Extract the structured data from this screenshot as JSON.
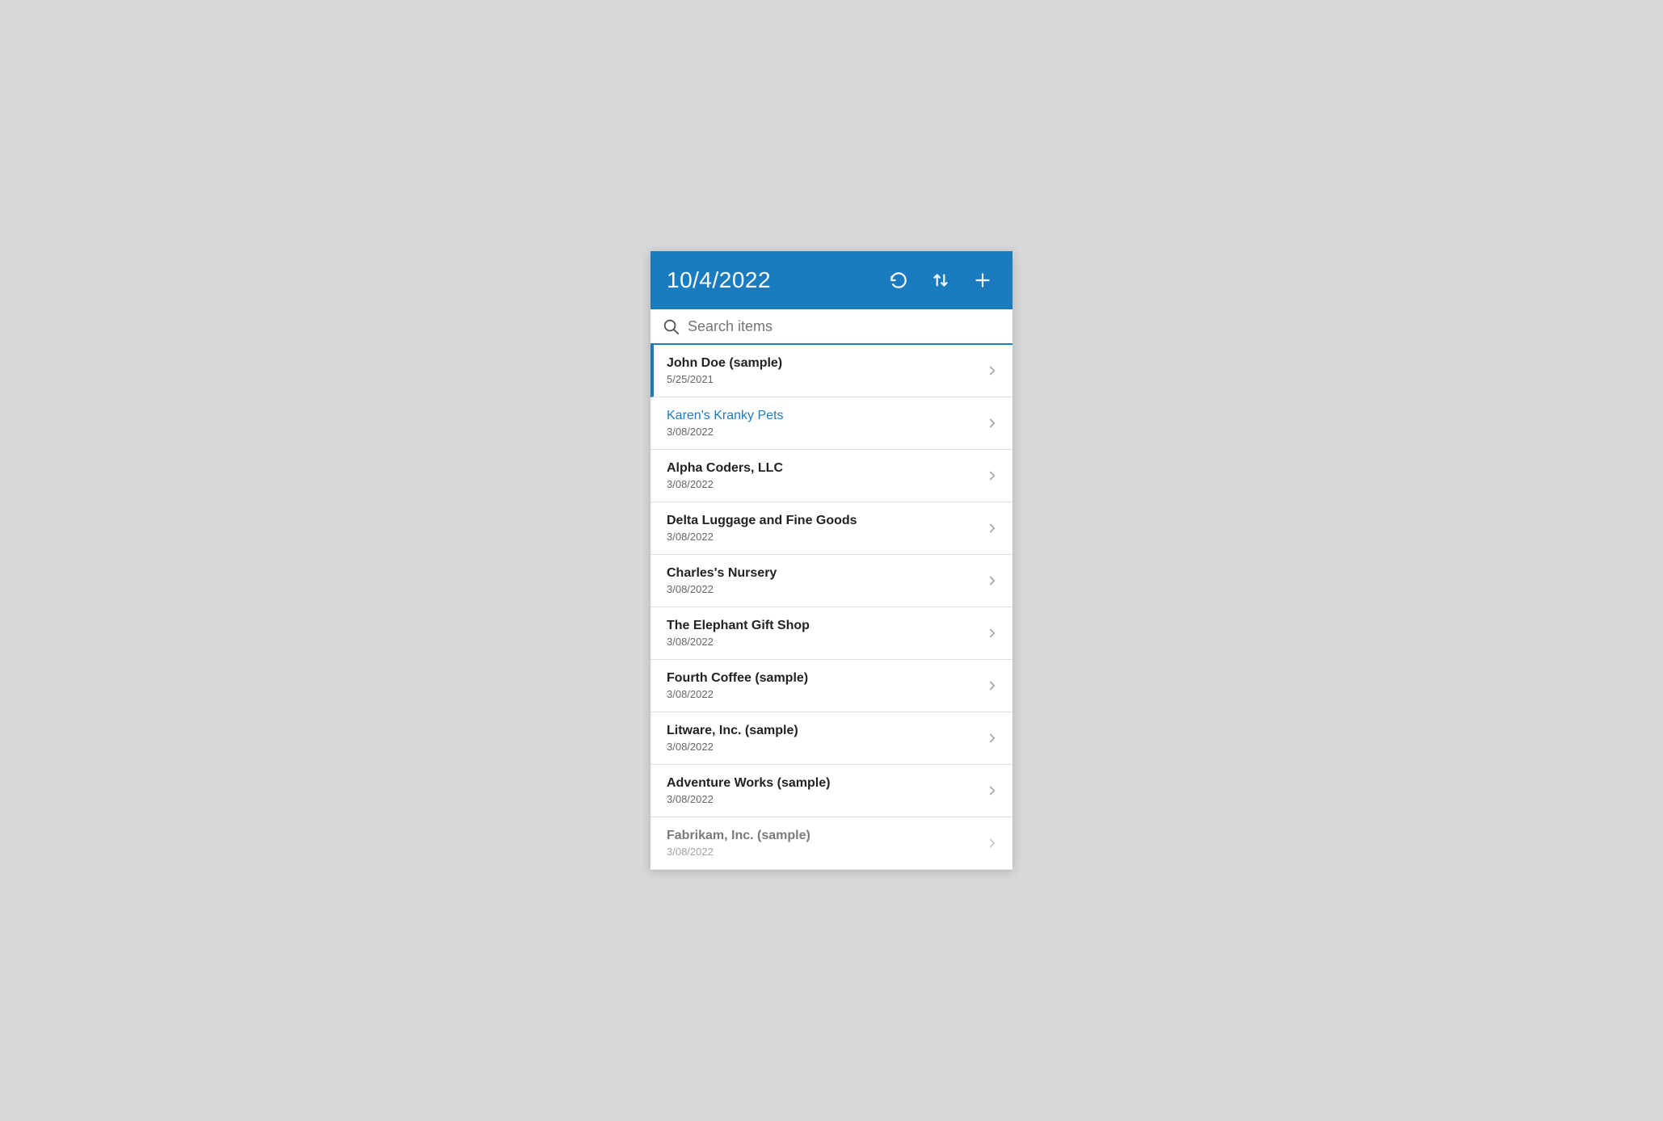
{
  "header": {
    "date": "10/4/2022",
    "refresh_label": "Refresh",
    "sort_label": "Sort",
    "add_label": "Add"
  },
  "search": {
    "placeholder": "Search items",
    "value": ""
  },
  "items": [
    {
      "id": 1,
      "name": "John Doe (sample)",
      "date": "5/25/2021",
      "is_selected": true,
      "is_link": false
    },
    {
      "id": 2,
      "name": "Karen's Kranky Pets",
      "date": "3/08/2022",
      "is_selected": false,
      "is_link": true
    },
    {
      "id": 3,
      "name": "Alpha Coders, LLC",
      "date": "3/08/2022",
      "is_selected": false,
      "is_link": false
    },
    {
      "id": 4,
      "name": "Delta Luggage and Fine Goods",
      "date": "3/08/2022",
      "is_selected": false,
      "is_link": false
    },
    {
      "id": 5,
      "name": "Charles's Nursery",
      "date": "3/08/2022",
      "is_selected": false,
      "is_link": false
    },
    {
      "id": 6,
      "name": "The Elephant Gift Shop",
      "date": "3/08/2022",
      "is_selected": false,
      "is_link": false
    },
    {
      "id": 7,
      "name": "Fourth Coffee (sample)",
      "date": "3/08/2022",
      "is_selected": false,
      "is_link": false
    },
    {
      "id": 8,
      "name": "Litware, Inc. (sample)",
      "date": "3/08/2022",
      "is_selected": false,
      "is_link": false
    },
    {
      "id": 9,
      "name": "Adventure Works (sample)",
      "date": "3/08/2022",
      "is_selected": false,
      "is_link": false
    },
    {
      "id": 10,
      "name": "Fabrikam, Inc. (sample)",
      "date": "3/08/2022",
      "is_selected": false,
      "is_link": false,
      "is_partial": true
    }
  ],
  "colors": {
    "accent": "#1a7bbf",
    "text_primary": "#222222",
    "text_secondary": "#666666",
    "link": "#1a7bbf",
    "chevron": "#aaaaaa",
    "divider": "#e0e0e0",
    "header_bg": "#1a7bbf"
  }
}
